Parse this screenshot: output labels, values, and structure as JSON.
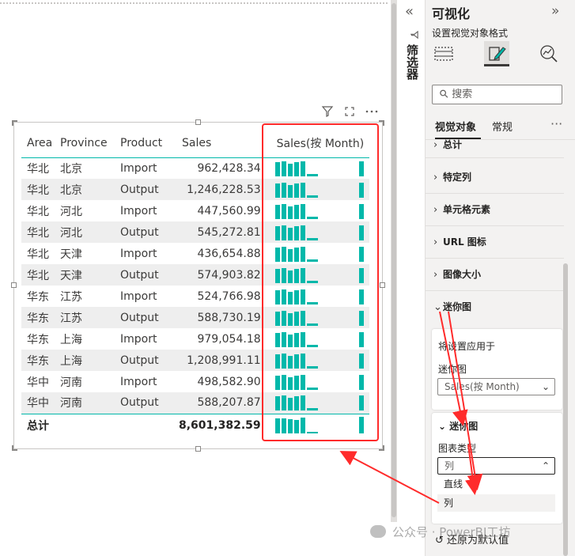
{
  "app": {
    "accent": "#01b8aa",
    "annotation_color": "#ff2b2b"
  },
  "table": {
    "columns": [
      "Area",
      "Province",
      "Product",
      "Sales",
      "Sales(按 Month)"
    ],
    "rows": [
      {
        "area": "华北",
        "province": "北京",
        "product": "Import",
        "sales": "962,428.34"
      },
      {
        "area": "华北",
        "province": "北京",
        "product": "Output",
        "sales": "1,246,228.53"
      },
      {
        "area": "华北",
        "province": "河北",
        "product": "Import",
        "sales": "447,560.99"
      },
      {
        "area": "华北",
        "province": "河北",
        "product": "Output",
        "sales": "545,272.81"
      },
      {
        "area": "华北",
        "province": "天津",
        "product": "Import",
        "sales": "436,654.88"
      },
      {
        "area": "华北",
        "province": "天津",
        "product": "Output",
        "sales": "574,903.82"
      },
      {
        "area": "华东",
        "province": "江苏",
        "product": "Import",
        "sales": "524,766.98"
      },
      {
        "area": "华东",
        "province": "江苏",
        "product": "Output",
        "sales": "588,730.19"
      },
      {
        "area": "华东",
        "province": "上海",
        "product": "Import",
        "sales": "979,054.18"
      },
      {
        "area": "华东",
        "province": "上海",
        "product": "Output",
        "sales": "1,208,991.11"
      },
      {
        "area": "华中",
        "province": "河南",
        "product": "Import",
        "sales": "498,582.90"
      },
      {
        "area": "华中",
        "province": "河南",
        "product": "Output",
        "sales": "588,207.87"
      }
    ],
    "total": {
      "label": "总计",
      "sales": "8,601,382.59"
    }
  },
  "filter_strip": {
    "label": "筛选器"
  },
  "pane": {
    "title": "可视化",
    "subtitle": "设置视觉对象格式",
    "search_placeholder": "搜索",
    "tab_visual": "视觉对象",
    "tab_general": "常规",
    "partial_section": "总计",
    "sections": [
      "特定列",
      "单元格元素",
      "URL 图标",
      "图像大小"
    ],
    "sparkline_section": "迷你图",
    "apply_label": "将设置应用于",
    "sparkline_field_label": "迷你图",
    "sparkline_field_value": "Sales(按 Month)",
    "type_card_title": "迷你图",
    "chart_type_label": "图表类型",
    "chart_type_value": "列",
    "option_line": "直线",
    "option_column": "列",
    "reset": "还原为默认值"
  },
  "watermark": "公众号 · PowerBI工坊",
  "icons": [
    "collapse-pane-icon",
    "filter-icon",
    "expand-pane-icon",
    "build-visual-icon",
    "format-visual-icon",
    "analytics-icon",
    "search-icon",
    "more-options-icon",
    "focus-mode-icon",
    "chevron-right-icon",
    "chevron-down-icon",
    "chevron-up-icon",
    "reset-icon"
  ]
}
